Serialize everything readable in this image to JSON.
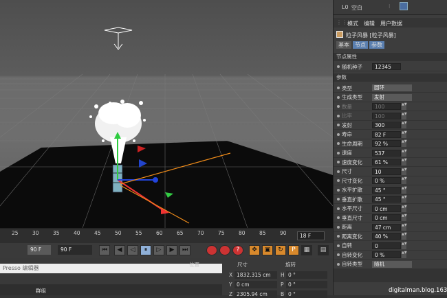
{
  "object_manager": {
    "layer_label": "L0",
    "item_label": "空白"
  },
  "attr_tabs": [
    "模式",
    "编辑",
    "用户数据"
  ],
  "object_title": "粒子风暴 [粒子风暴]",
  "subtabs": [
    "基本",
    "节点",
    "参数"
  ],
  "section_node": "节点属性",
  "seed": {
    "label": "随机种子",
    "value": "12345"
  },
  "section_params": "参数",
  "params": [
    {
      "label": "类型",
      "value": "圆环",
      "kind": "dropdown"
    },
    {
      "label": "生成类型",
      "value": "发射",
      "kind": "dropdown"
    },
    {
      "label": "数量",
      "value": "100",
      "disabled": true
    },
    {
      "label": "比率",
      "value": "100",
      "disabled": true
    },
    {
      "label": "发射",
      "value": "300"
    },
    {
      "label": "寿命",
      "value": "82 F"
    },
    {
      "label": "生命周期",
      "value": "92 %"
    },
    {
      "label": "速度",
      "value": "537"
    },
    {
      "label": "速度变化",
      "value": "61 %"
    },
    {
      "label": "尺寸",
      "value": "10"
    },
    {
      "label": "尺寸变化",
      "value": "0 %"
    },
    {
      "label": "水平扩散",
      "value": "45 °"
    },
    {
      "label": "垂直扩散",
      "value": "45 °"
    },
    {
      "label": "水平尺寸",
      "value": "0 cm"
    },
    {
      "label": "垂直尺寸",
      "value": "0 cm"
    },
    {
      "label": "距离",
      "value": "47 cm"
    },
    {
      "label": "距离变化",
      "value": "40 %"
    },
    {
      "label": "自转",
      "value": "0"
    },
    {
      "label": "自转变化",
      "value": "0 %"
    },
    {
      "label": "自转类型",
      "value": "随机",
      "kind": "dropdown"
    },
    {
      "label": "自转轴心",
      "value": "0",
      "disabled": true
    }
  ],
  "timeline": {
    "ticks": [
      "25",
      "30",
      "35",
      "40",
      "45",
      "50",
      "55",
      "60",
      "65",
      "70",
      "75",
      "80",
      "85",
      "90"
    ],
    "current_frame": "18 F"
  },
  "transport": {
    "start_field": "90 F",
    "end_field": "90 F"
  },
  "bottom": {
    "editor_title": "Presso 编辑器",
    "group_label": "群组",
    "pos_header": "位置",
    "size_header": "尺寸",
    "rot_header": "旋转",
    "x_value": "1832.315 cm",
    "y_value": "0 cm",
    "z_value": "2305.94 cm",
    "h_value": "0 °",
    "p_value": "0 °",
    "b_value": "0 °"
  },
  "watermark": "digitalman.blog.163.com"
}
